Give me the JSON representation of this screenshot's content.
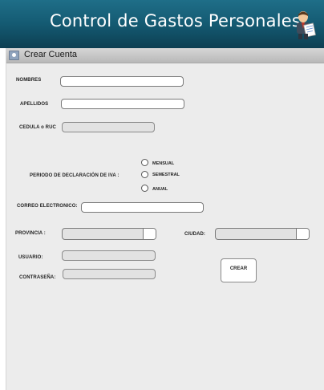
{
  "header": {
    "title": "Control de Gastos Personales"
  },
  "section": {
    "title": "Crear Cuenta"
  },
  "form": {
    "nombres_label": "NOMBRES",
    "apellidos_label": "APELLIDOS",
    "cedula_label": "CEDULA o RUC",
    "periodo_label": "PERIODO DE DECLARACIÓN DE IVA :",
    "periodo_options": [
      "MENSUAL",
      "SEMESTRAL",
      "ANUAL"
    ],
    "correo_label": "CORREO ELECTRONICO:",
    "provincia_label": "PROVINCIA :",
    "ciudad_label": "CIUDAD:",
    "usuario_label": "USUARIO:",
    "contrasena_label": "CONTRASEÑA:",
    "crear_button": "CREAR"
  },
  "colors": {
    "header": "#145a72",
    "panel": "#ececec",
    "section_bar": "#c4c4c4"
  },
  "icons": {
    "header_mascot": "businessman-with-document-icon",
    "section": "user-icon",
    "combo_arrow": "dropdown-arrow-button"
  }
}
